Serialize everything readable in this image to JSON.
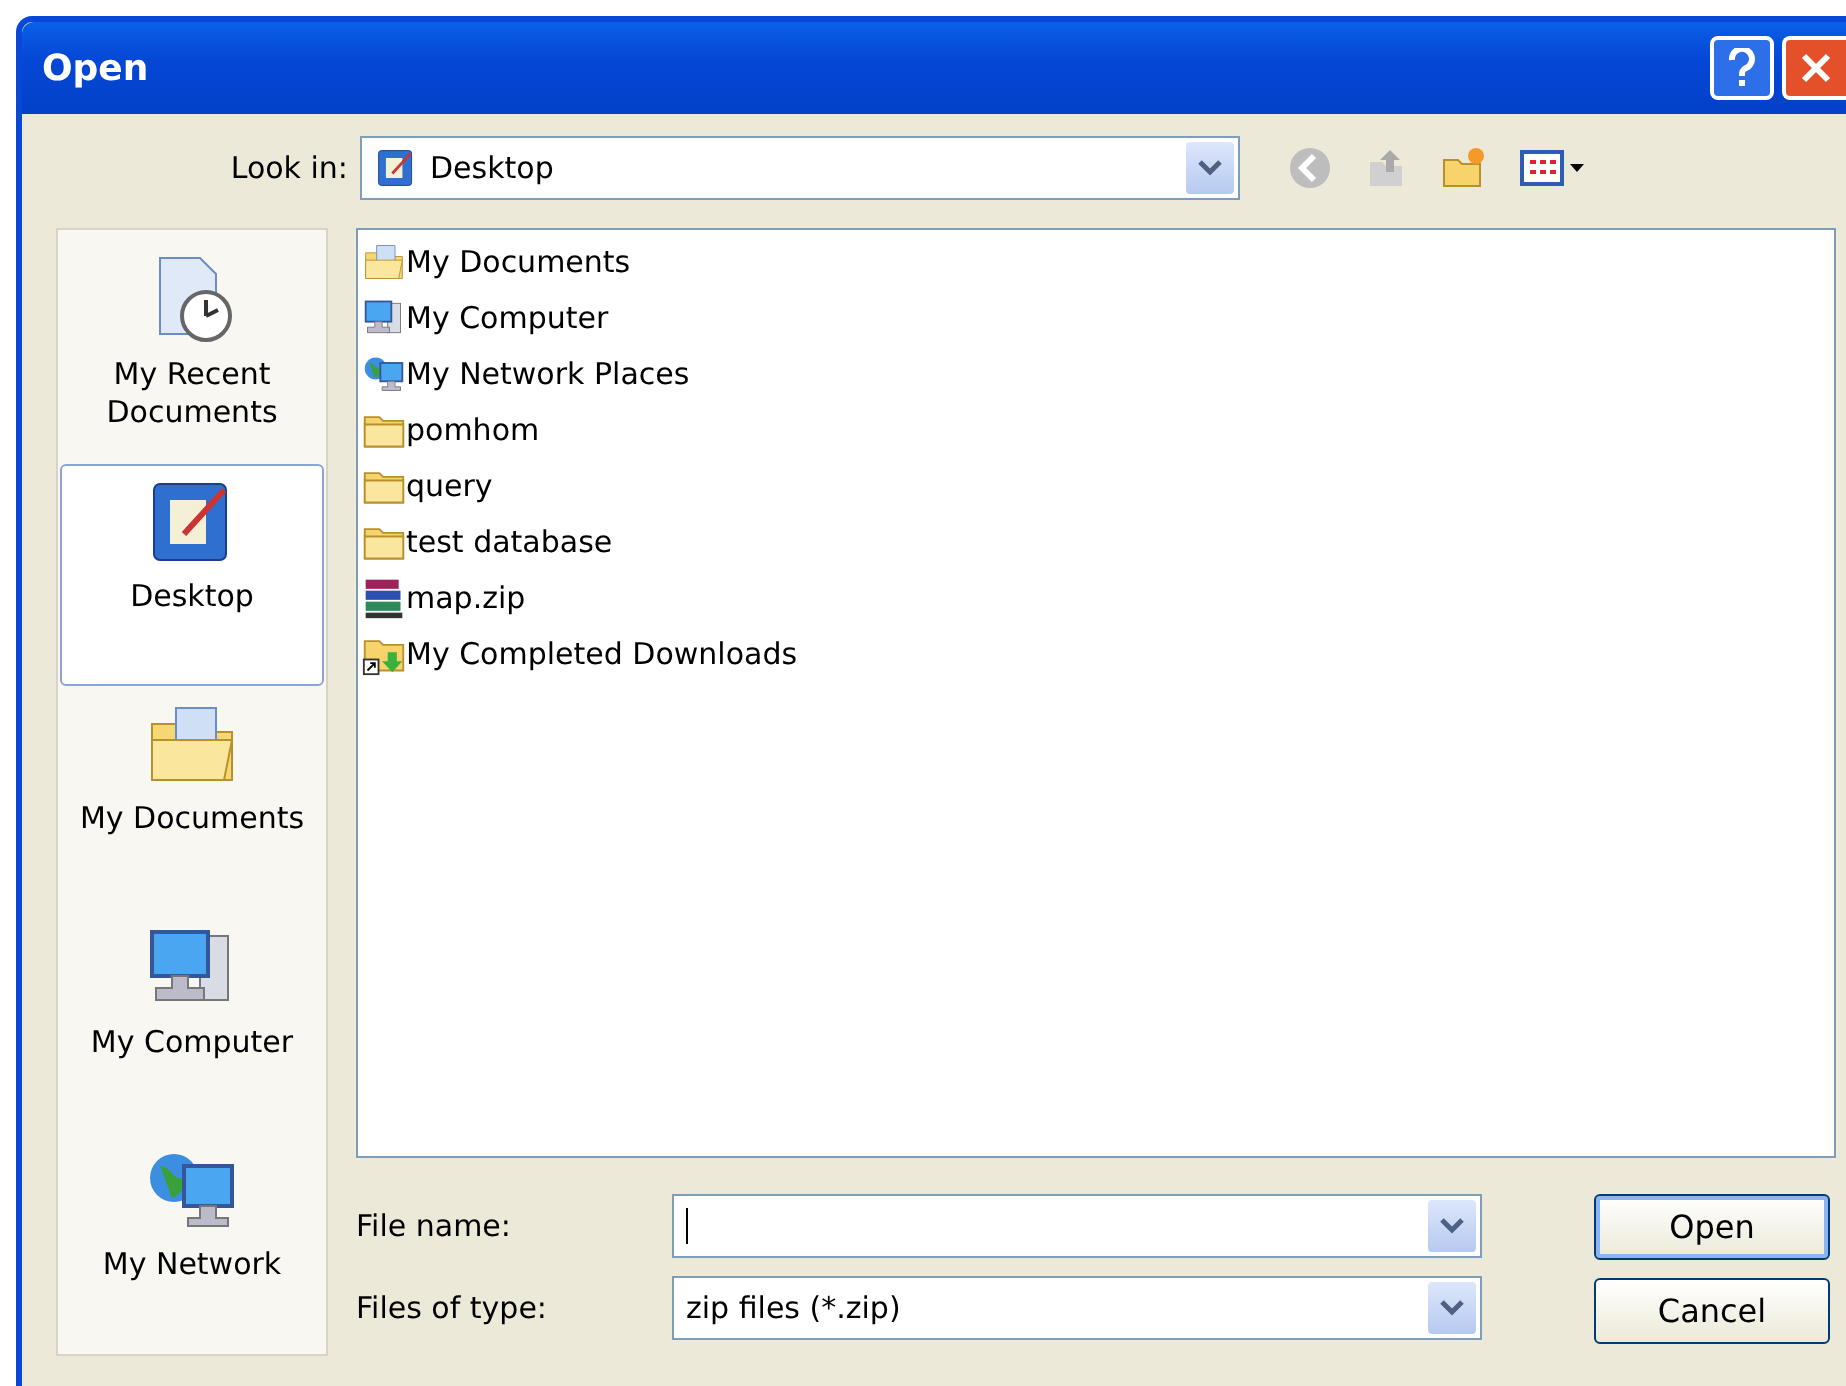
{
  "window": {
    "title": "Open"
  },
  "look_in": {
    "label": "Look in:",
    "value": "Desktop"
  },
  "places": [
    {
      "kind": "recent",
      "label": "My Recent Documents",
      "selected": false
    },
    {
      "kind": "desktop",
      "label": "Desktop",
      "selected": true
    },
    {
      "kind": "documents",
      "label": "My Documents",
      "selected": false
    },
    {
      "kind": "computer",
      "label": "My Computer",
      "selected": false
    },
    {
      "kind": "network",
      "label": "My Network",
      "selected": false
    }
  ],
  "files": [
    {
      "kind": "documents",
      "name": "My Documents"
    },
    {
      "kind": "computer",
      "name": "My Computer"
    },
    {
      "kind": "network",
      "name": "My Network Places"
    },
    {
      "kind": "folder",
      "name": "pomhom"
    },
    {
      "kind": "folder",
      "name": "query"
    },
    {
      "kind": "folder",
      "name": "test database"
    },
    {
      "kind": "zip",
      "name": "map.zip"
    },
    {
      "kind": "shortcut",
      "name": "My Completed Downloads"
    }
  ],
  "file_name": {
    "label": "File name:"
  },
  "file_type": {
    "label": "Files of type:",
    "value": "zip files (*.zip)"
  },
  "buttons": [
    {
      "kind": "primary",
      "label": "Open"
    },
    {
      "kind": "normal",
      "label": "Cancel"
    }
  ]
}
